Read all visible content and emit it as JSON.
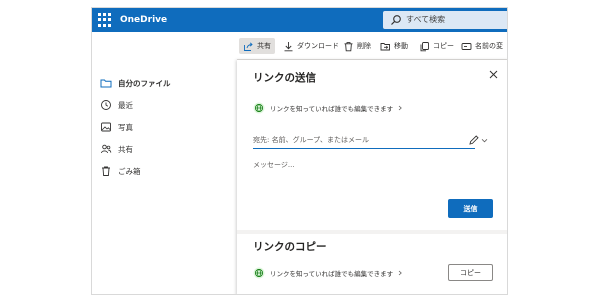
{
  "app": {
    "brand": "OneDrive"
  },
  "search": {
    "placeholder": "すべて検索"
  },
  "nav": {
    "items": [
      {
        "label": "自分のファイル",
        "icon": "folder-icon",
        "active": true
      },
      {
        "label": "最近",
        "icon": "recent-icon",
        "active": false
      },
      {
        "label": "写真",
        "icon": "photo-icon",
        "active": false
      },
      {
        "label": "共有",
        "icon": "people-icon",
        "active": false
      },
      {
        "label": "ごみ箱",
        "icon": "trash-icon",
        "active": false
      }
    ]
  },
  "toolbar": {
    "share": "共有",
    "download": "ダウンロード",
    "delete": "削除",
    "move": "移動",
    "copy": "コピー",
    "rename": "名前の変"
  },
  "panel": {
    "send_title": "リンクの送信",
    "link_setting": "リンクを知っていれば誰でも編集できます",
    "recipient_placeholder": "宛先: 名前、グループ、またはメール",
    "message_placeholder": "メッセージ...",
    "send_button": "送信",
    "copy_title": "リンクのコピー",
    "copy_link_setting": "リンクを知っていれば誰でも編集できます",
    "copy_button": "コピー"
  },
  "colors": {
    "accent": "#0f6cbd",
    "globe": "#107c10"
  }
}
